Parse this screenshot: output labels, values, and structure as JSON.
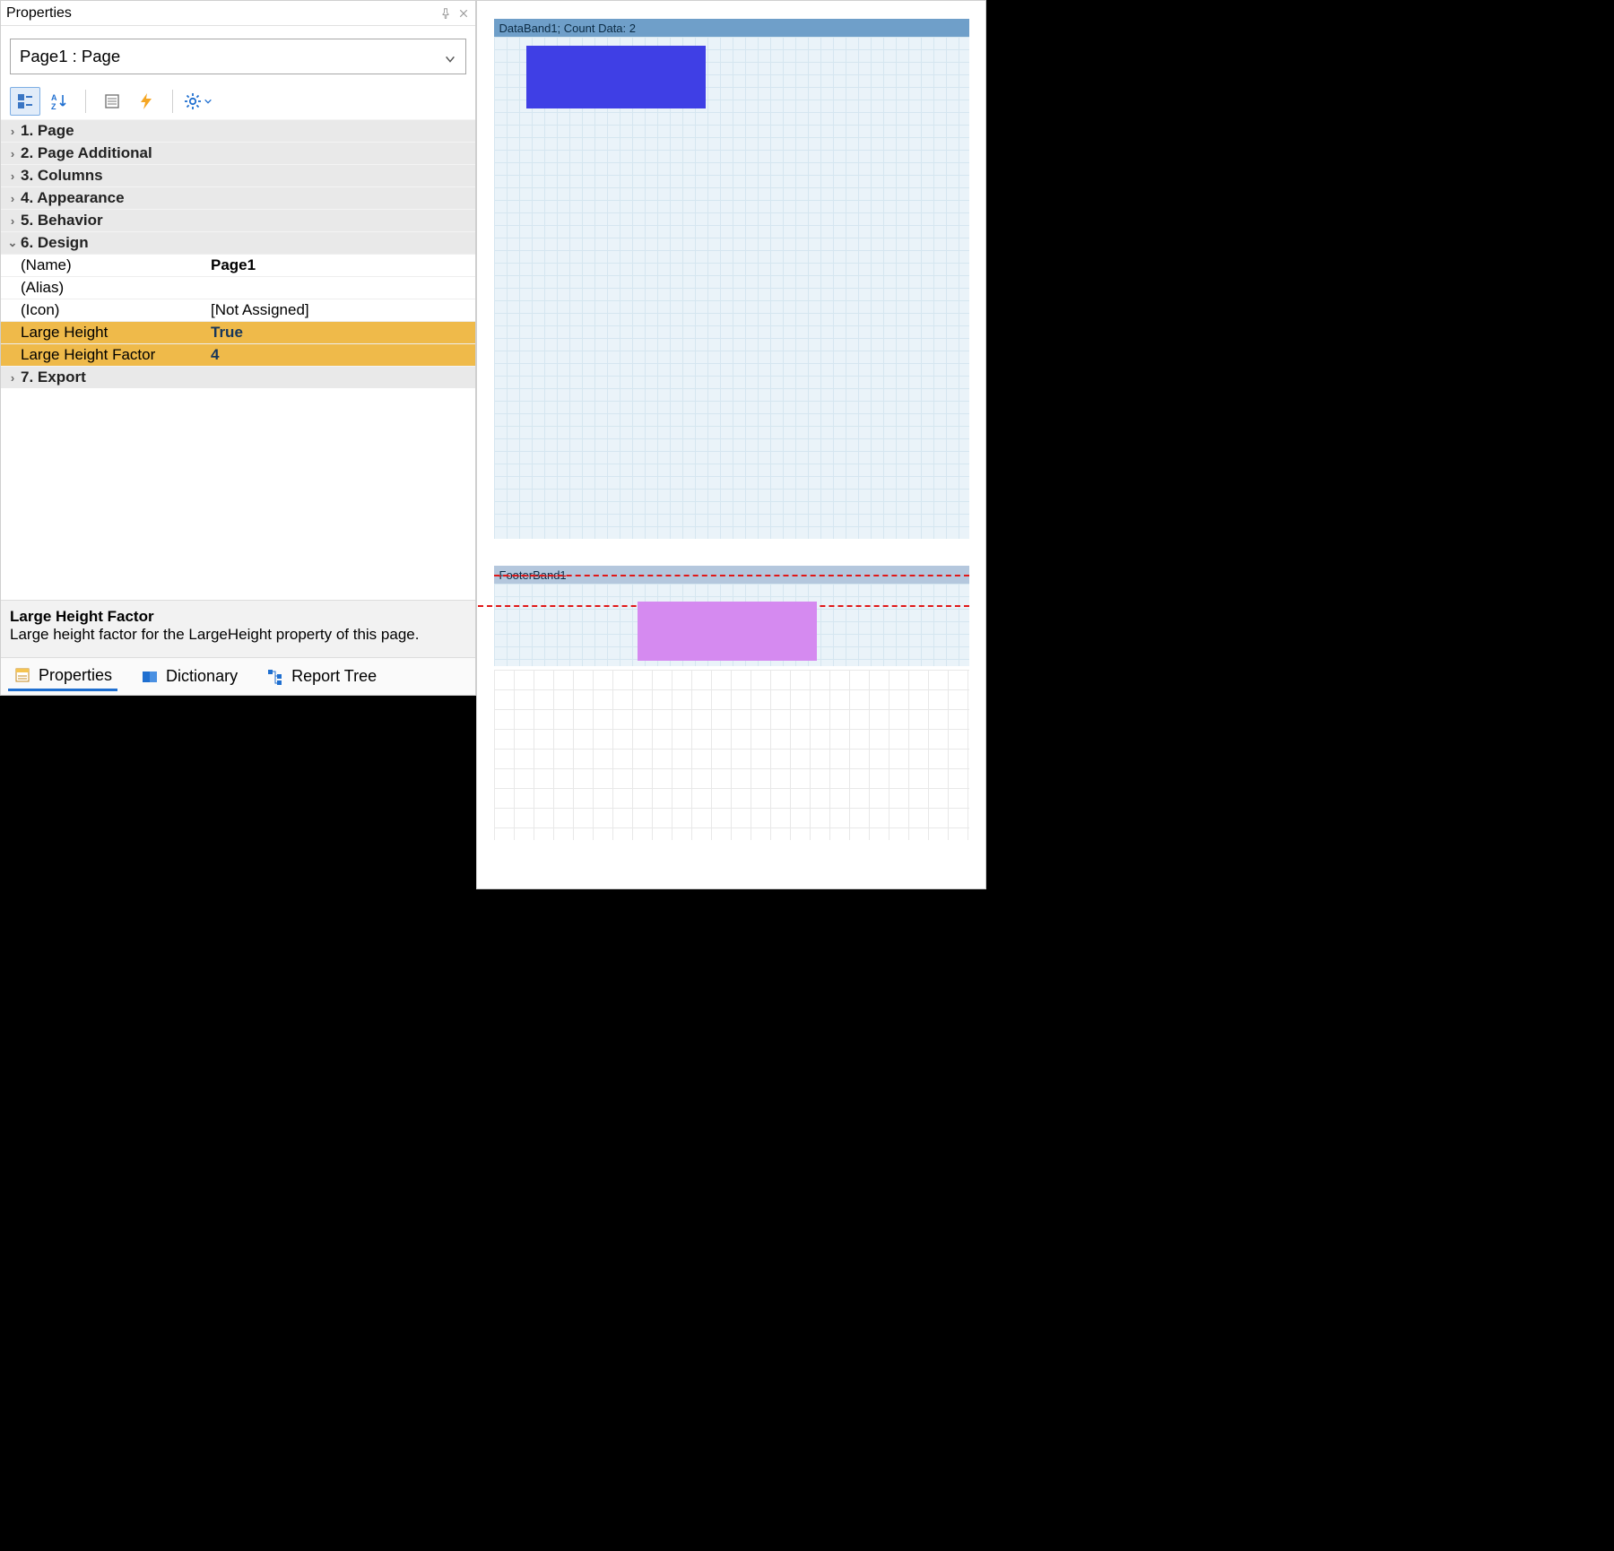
{
  "panel": {
    "title": "Properties",
    "object_selector": "Page1 : Page",
    "categories": [
      {
        "label": "1. Page",
        "expanded": false
      },
      {
        "label": "2. Page  Additional",
        "expanded": false
      },
      {
        "label": "3. Columns",
        "expanded": false
      },
      {
        "label": "4. Appearance",
        "expanded": false
      },
      {
        "label": "5. Behavior",
        "expanded": false
      },
      {
        "label": "6. Design",
        "expanded": true
      },
      {
        "label": "7. Export",
        "expanded": false
      }
    ],
    "design_props": [
      {
        "name": "(Name)",
        "value": "Page1",
        "bold": true
      },
      {
        "name": "(Alias)",
        "value": ""
      },
      {
        "name": "(Icon)",
        "value": "[Not Assigned]"
      },
      {
        "name": "Large Height",
        "value": "True",
        "highlight": true
      },
      {
        "name": "Large Height Factor",
        "value": "4",
        "highlight": true
      }
    ],
    "description": {
      "title": "Large Height Factor",
      "text": "Large height factor for the LargeHeight property of this page."
    },
    "bottom_tabs": {
      "properties": "Properties",
      "dictionary": "Dictionary",
      "report_tree": "Report Tree"
    }
  },
  "design": {
    "data_band_header": "DataBand1; Count Data: 2",
    "footer_band_header": "FooterBand1"
  }
}
